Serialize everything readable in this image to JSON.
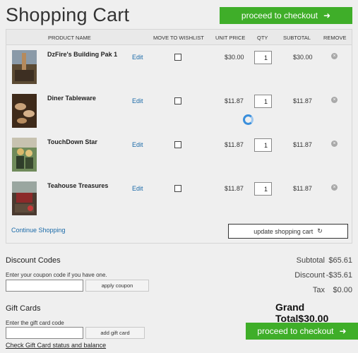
{
  "page": {
    "title": "Shopping Cart"
  },
  "checkout": {
    "label": "proceed to checkout",
    "arrow": "➜"
  },
  "table": {
    "headers": {
      "product_name": "PRODUCT NAME",
      "move_to_wishlist": "MOVE TO WISHLIST",
      "unit_price": "UNIT PRICE",
      "qty": "QTY",
      "subtotal": "SUBTOTAL",
      "remove": "REMOVE"
    },
    "rows": [
      {
        "name": "DzFire's Building Pak 1",
        "edit": "Edit",
        "price": "$30.00",
        "qty": "1",
        "subtotal": "$30.00",
        "remove_icon": "×"
      },
      {
        "name": "Diner Tableware",
        "edit": "Edit",
        "price": "$11.87",
        "qty": "1",
        "subtotal": "$11.87",
        "remove_icon": "×"
      },
      {
        "name": "TouchDown Star",
        "edit": "Edit",
        "price": "$11.87",
        "qty": "1",
        "subtotal": "$11.87",
        "remove_icon": "×"
      },
      {
        "name": "Teahouse Treasures",
        "edit": "Edit",
        "price": "$11.87",
        "qty": "1",
        "subtotal": "$11.87",
        "remove_icon": "×"
      }
    ],
    "continue_label": "Continue Shopping",
    "update_label": "update shopping cart",
    "update_icon": "↻"
  },
  "discount": {
    "title": "Discount Codes",
    "help": "Enter your coupon code if you have one.",
    "button": "apply coupon"
  },
  "gift": {
    "title": "Gift Cards",
    "help": "Enter the gift card code",
    "button": "add gift card",
    "link": "Check Gift Card status and balance"
  },
  "totals": {
    "subtotal_label": "Subtotal",
    "subtotal": "$65.61",
    "discount_label": "Discount",
    "discount": "-$35.61",
    "tax_label": "Tax",
    "tax": "$0.00",
    "grand_label": "Grand Total",
    "grand": "$30.00"
  },
  "colors": {
    "accent": "#3fae29",
    "link": "#1a6aa8",
    "spinner": "#3a8fdc"
  }
}
